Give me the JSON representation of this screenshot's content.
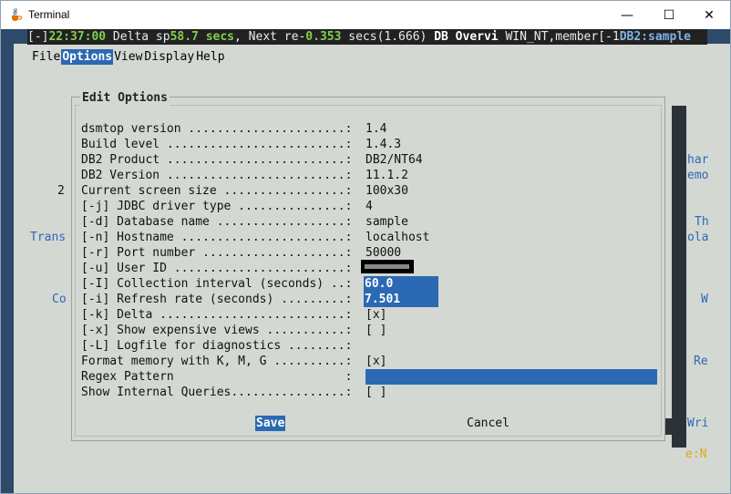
{
  "window": {
    "title": "Terminal",
    "minimize_glyph": "—",
    "maximize_glyph": "☐",
    "close_glyph": "✕",
    "app_icon": "java-cup-icon"
  },
  "statusbar": {
    "bracket_open": "[-]",
    "time": "22:37:00",
    "label_delta": " Delta sp",
    "delta_secs": "58.7 secs",
    "label_next": ", Next re-",
    "next_val": "0.353",
    "label_secs": " secs(1.666) ",
    "db_overview": "DB Overvi",
    "instance": " WIN_NT,member[-1",
    "db_name": "DB2:sample"
  },
  "menu": [
    "File",
    "Options",
    "View",
    "Display",
    "Help"
  ],
  "background_text": {
    "num_2": "2",
    "trans": "Trans",
    "co": "Co",
    "har": "har",
    "emo": "emo",
    "th": "Th",
    "ola": "ola",
    "w": "W",
    "re": "Re",
    "wri": "Wri",
    "status_e": "e:N"
  },
  "dialog": {
    "title": "Edit Options",
    "rows": [
      {
        "label": "dsmtop version ......................:",
        "value": "1.4"
      },
      {
        "label": "Build level .........................:",
        "value": "1.4.3"
      },
      {
        "label": "DB2 Product .........................:",
        "value": "DB2/NT64"
      },
      {
        "label": "DB2 Version .........................:",
        "value": "11.1.2"
      },
      {
        "label": "Current screen size .................:",
        "value": "100x30"
      },
      {
        "label": "[-j] JDBC driver type ...............:",
        "value": "4"
      },
      {
        "label": "[-d] Database name ..................:",
        "value": "sample"
      },
      {
        "label": "[-n] Hostname .......................:",
        "value": "localhost"
      },
      {
        "label": "[-r] Port number ....................:",
        "value": "50000"
      },
      {
        "label": "[-u] User ID ........................:",
        "value": ""
      },
      {
        "label": "[-I] Collection interval (seconds) ..:",
        "value": "60.0"
      },
      {
        "label": "[-i] Refresh rate (seconds) .........:",
        "value": "7.501"
      },
      {
        "label": "[-k] Delta ..........................:",
        "value": "[x]"
      },
      {
        "label": "[-x] Show expensive views ...........:",
        "value": "[ ]"
      },
      {
        "label": "[-L] Logfile for diagnostics ........:",
        "value": ""
      },
      {
        "label": "Format memory with K, M, G ..........:",
        "value": "[x]"
      },
      {
        "label": "Regex Pattern                        :",
        "value": ""
      },
      {
        "label": "Show Internal Queries................:",
        "value": "[ ]"
      }
    ],
    "save_label": "Save",
    "cancel_label": "Cancel"
  },
  "colors": {
    "accent_blue": "#2b69b4",
    "status_green": "#7fd04c",
    "terminal_bg": "#d4d8d2",
    "outer_bg": "#2d4a6b"
  }
}
